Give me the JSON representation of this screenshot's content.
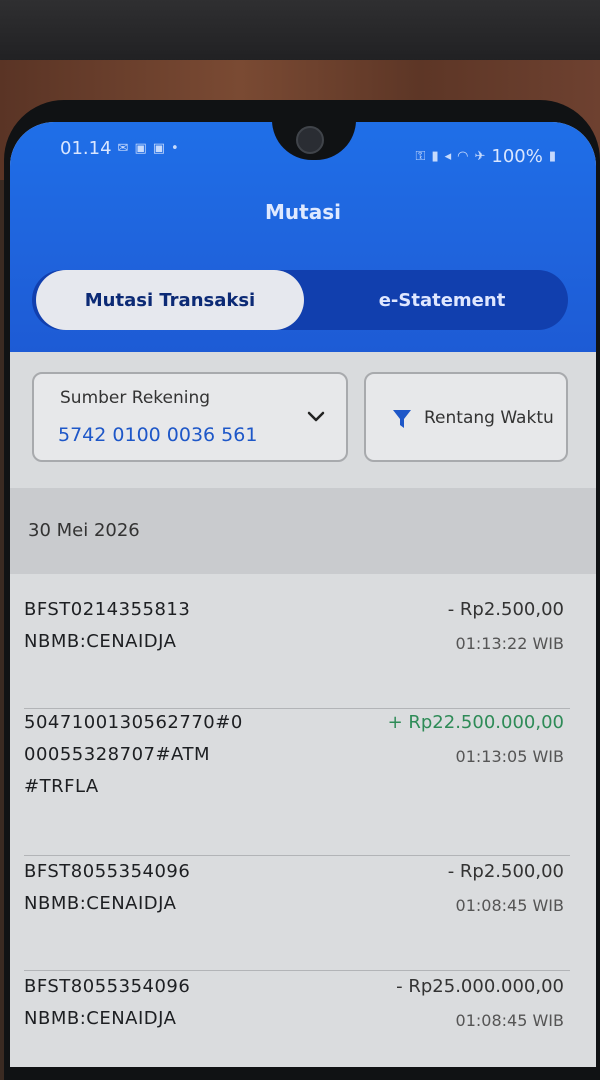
{
  "status_bar": {
    "time": "01.14",
    "battery": "100%"
  },
  "header": {
    "title": "Mutasi",
    "tabs": [
      {
        "label": "Mutasi Transaksi",
        "active": true
      },
      {
        "label": "e-Statement",
        "active": false
      }
    ]
  },
  "account_source": {
    "label": "Sumber Rekening",
    "value": "5742 0100 0036 561"
  },
  "filter": {
    "label": "Rentang Waktu"
  },
  "date_group": "30 Mei 2026",
  "transactions": [
    {
      "desc_lines": [
        "BFST0214355813",
        "NBMB:CENAIDJA"
      ],
      "amount": "- Rp2.500,00",
      "type": "debit",
      "time": "01:13:22 WIB"
    },
    {
      "desc_lines": [
        "5047100130562770#0",
        "00055328707#ATM",
        "#TRFLA"
      ],
      "amount": "+ Rp22.500.000,00",
      "type": "credit",
      "time": "01:13:05 WIB"
    },
    {
      "desc_lines": [
        "BFST8055354096",
        "NBMB:CENAIDJA"
      ],
      "amount": "- Rp2.500,00",
      "type": "debit",
      "time": "01:08:45 WIB"
    },
    {
      "desc_lines": [
        "BFST8055354096",
        "NBMB:CENAIDJA"
      ],
      "amount": "- Rp25.000.000,00",
      "type": "debit",
      "time": "01:08:45 WIB"
    }
  ],
  "colors": {
    "header_blue": "#1f63dc",
    "accent_blue": "#1e57c8",
    "credit_green": "#2e8b57"
  }
}
